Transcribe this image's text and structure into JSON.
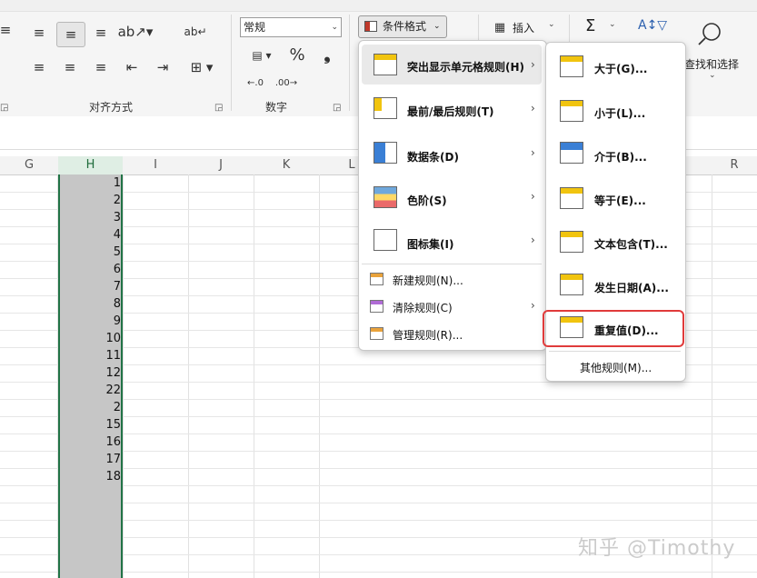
{
  "ribbon": {
    "alignment_group_label": "对齐方式",
    "number_group_label": "数字",
    "number_format_value": "常规",
    "percent_symbol": "%",
    "comma_symbol": "❟",
    "conditional_format_label": "条件格式",
    "insert_label": "插入",
    "find_select_label": "查找和选择",
    "sum_symbol": "Σ"
  },
  "columns": [
    "G",
    "H",
    "I",
    "J",
    "K",
    "L",
    "R"
  ],
  "selected_column": "H",
  "column_h_values": [
    "1",
    "2",
    "3",
    "4",
    "5",
    "6",
    "7",
    "8",
    "9",
    "10",
    "11",
    "12",
    "22",
    "2",
    "15",
    "16",
    "17",
    "18"
  ],
  "cf_menu": {
    "items": [
      {
        "label": "突出显示单元格规则(H)",
        "has_submenu": true
      },
      {
        "label": "最前/最后规则(T)",
        "has_submenu": true
      },
      {
        "label": "数据条(D)",
        "has_submenu": true
      },
      {
        "label": "色阶(S)",
        "has_submenu": true
      },
      {
        "label": "图标集(I)",
        "has_submenu": true
      },
      {
        "label": "新建规则(N)...",
        "has_submenu": false
      },
      {
        "label": "清除规则(C)",
        "has_submenu": true
      },
      {
        "label": "管理规则(R)...",
        "has_submenu": false
      }
    ]
  },
  "submenu": {
    "items": [
      {
        "label": "大于(G)..."
      },
      {
        "label": "小于(L)..."
      },
      {
        "label": "介于(B)..."
      },
      {
        "label": "等于(E)..."
      },
      {
        "label": "文本包含(T)..."
      },
      {
        "label": "发生日期(A)..."
      },
      {
        "label": "重复值(D)..."
      }
    ],
    "footer": "其他规则(M)...",
    "highlighted_item": "重复值(D)..."
  },
  "watermark": "知乎 @Timothy",
  "colors": {
    "selection_border": "#217346",
    "highlight_box": "#e03b3b",
    "selected_fill": "#c6c6c6"
  }
}
